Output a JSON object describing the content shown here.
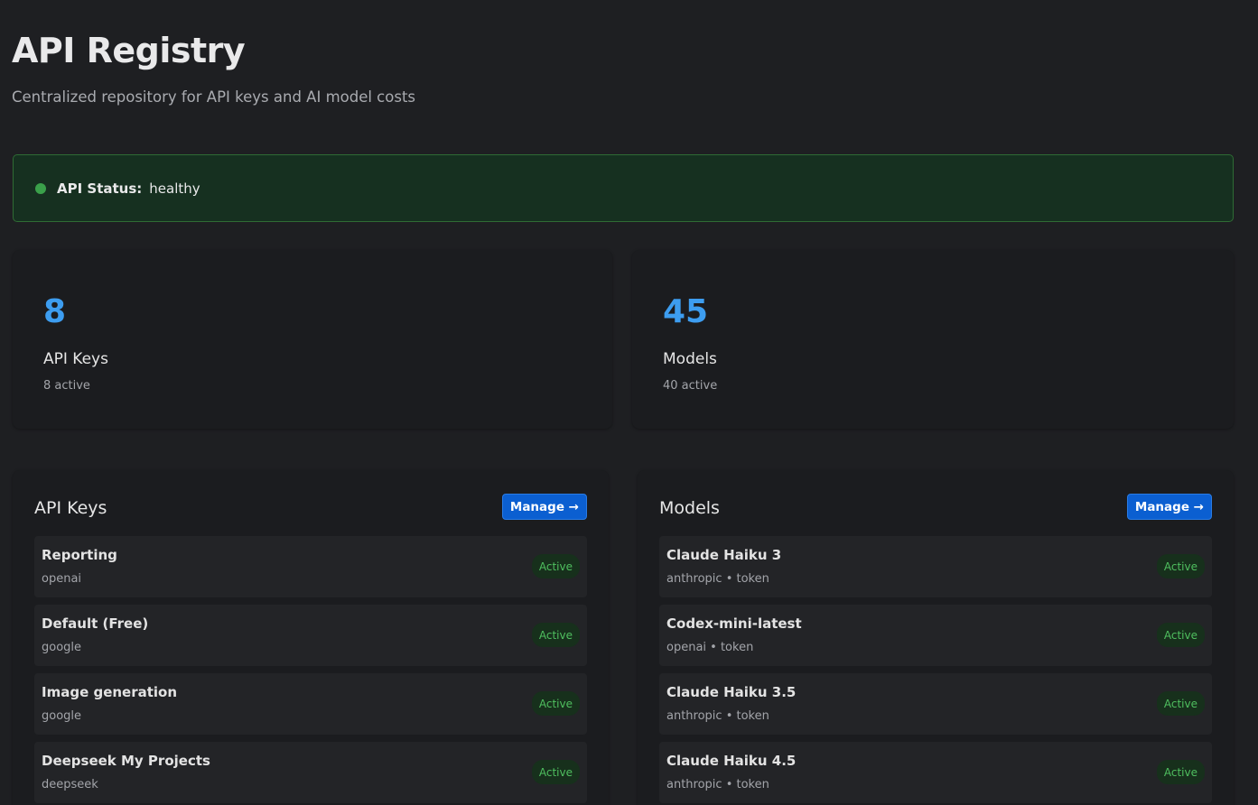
{
  "header": {
    "title": "API Registry",
    "subtitle": "Centralized repository for API keys and AI model costs"
  },
  "status": {
    "label": "API Status:",
    "value": "healthy",
    "color": "#3aa04a"
  },
  "stats": {
    "keys": {
      "count": "8",
      "name": "API Keys",
      "sub": "8 active"
    },
    "models": {
      "count": "45",
      "name": "Models",
      "sub": "40 active"
    }
  },
  "panels": {
    "keys": {
      "title": "API Keys",
      "manage_label": "Manage →",
      "items": [
        {
          "name": "Reporting",
          "sub": "openai",
          "status": "Active"
        },
        {
          "name": "Default (Free)",
          "sub": "google",
          "status": "Active"
        },
        {
          "name": "Image generation",
          "sub": "google",
          "status": "Active"
        },
        {
          "name": "Deepseek My Projects",
          "sub": "deepseek",
          "status": "Active"
        }
      ]
    },
    "models": {
      "title": "Models",
      "manage_label": "Manage →",
      "items": [
        {
          "name": "Claude Haiku 3",
          "sub": "anthropic • token",
          "status": "Active"
        },
        {
          "name": "Codex-mini-latest",
          "sub": "openai • token",
          "status": "Active"
        },
        {
          "name": "Claude Haiku 3.5",
          "sub": "anthropic • token",
          "status": "Active"
        },
        {
          "name": "Claude Haiku 4.5",
          "sub": "anthropic • token",
          "status": "Active"
        }
      ]
    }
  },
  "colors": {
    "accent": "#3d9df0",
    "button": "#0b5fd1",
    "active_badge": "#4fbf5f"
  }
}
